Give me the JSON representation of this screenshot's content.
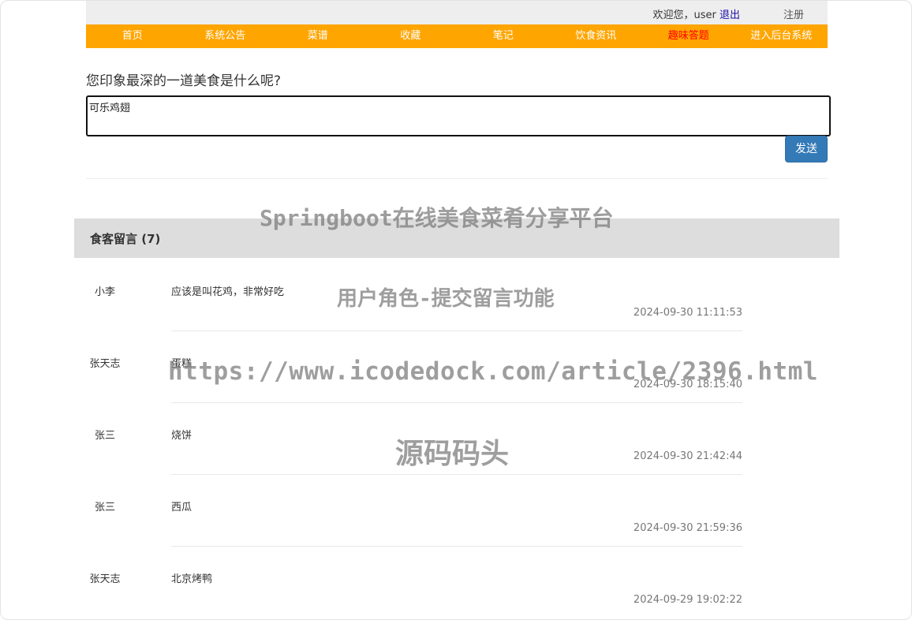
{
  "topbar": {
    "welcome": "欢迎您，user",
    "logout": "退出",
    "register": "注册"
  },
  "nav": {
    "items": [
      "首页",
      "系统公告",
      "菜谱",
      "收藏",
      "笔记",
      "饮食资讯",
      "趣味答题",
      "进入后台系统"
    ]
  },
  "form": {
    "question": "您印象最深的一道美食是什么呢?",
    "input_value": "可乐鸡翅",
    "send_label": "发送"
  },
  "comments": {
    "title": "食客留言 (7)",
    "items": [
      {
        "author": "小李",
        "content": "应该是叫花鸡，非常好吃",
        "time": "2024-09-30 11:11:53"
      },
      {
        "author": "张天志",
        "content": "蛋糕",
        "time": "2024-09-30 18:15:40"
      },
      {
        "author": "张三",
        "content": "烧饼",
        "time": "2024-09-30 21:42:44"
      },
      {
        "author": "张三",
        "content": "西瓜",
        "time": "2024-09-30 21:59:36"
      },
      {
        "author": "张天志",
        "content": "北京烤鸭",
        "time": "2024-09-29 19:02:22"
      }
    ]
  },
  "watermarks": {
    "title": "Springboot在线美食菜肴分享平台",
    "feature": "用户角色-提交留言功能",
    "url": "https://www.icodedock.com/article/2396.html",
    "brand": "源码码头"
  },
  "colors": {
    "nav_bg": "#ffa500",
    "nav_active": "#ff0000",
    "button_primary": "#337ab7"
  }
}
